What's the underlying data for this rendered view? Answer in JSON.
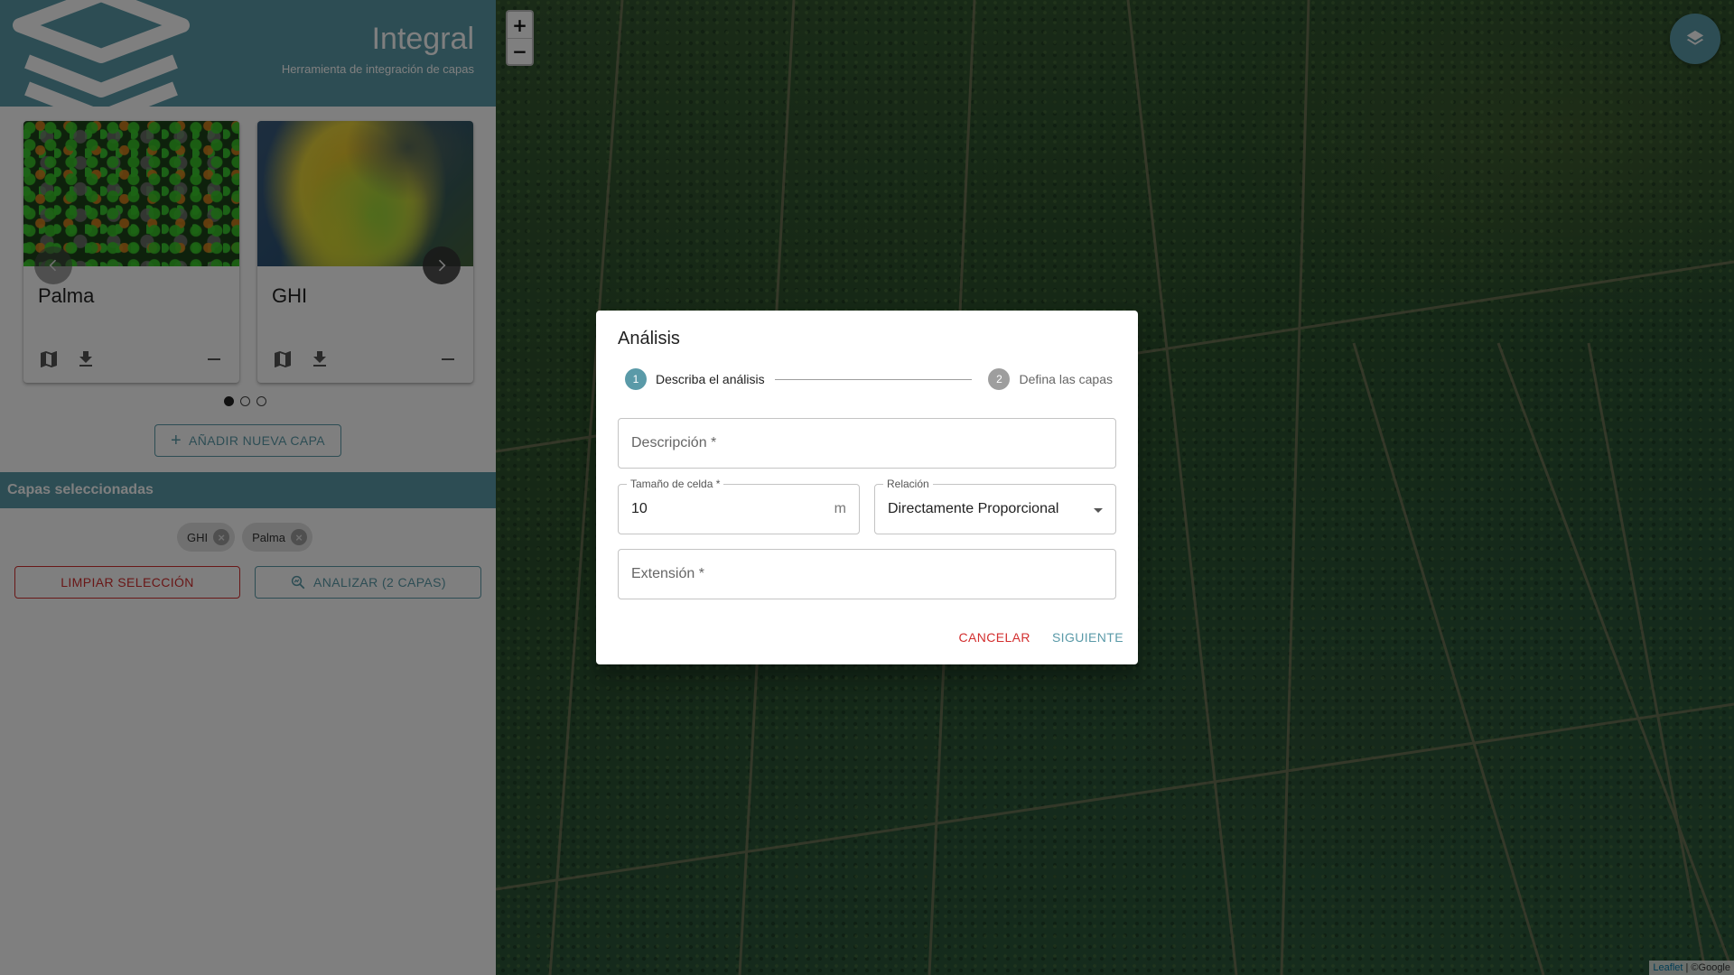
{
  "header": {
    "title": "Integral",
    "subtitle": "Herramienta de integración de capas"
  },
  "cards": [
    {
      "name": "Palma"
    },
    {
      "name": "GHI"
    }
  ],
  "carousel": {
    "pages": 3,
    "active_page": 1
  },
  "add_layer": {
    "label": "AÑADIR NUEVA CAPA"
  },
  "selected": {
    "title": "Capas seleccionadas",
    "chips": [
      "GHI",
      "Palma"
    ],
    "clear_label": "LIMPIAR SELECCIÓN",
    "analyze_label": "ANALIZAR (2 CAPAS)"
  },
  "map": {
    "zoom_in": "+",
    "zoom_out": "−",
    "attribution_leaflet": "Leaflet",
    "attribution_rest": " | ©Google"
  },
  "dialog": {
    "title": "Análisis",
    "steps": [
      {
        "num": "1",
        "label": "Describa el análisis"
      },
      {
        "num": "2",
        "label": "Defina las capas"
      }
    ],
    "fields": {
      "description": {
        "label": "Descripción *",
        "value": ""
      },
      "cell_size": {
        "label": "Tamaño de celda *",
        "value": "10",
        "unit": "m"
      },
      "relation": {
        "label": "Relación",
        "value": "Directamente Proporcional"
      },
      "extent": {
        "label": "Extensión *",
        "value": ""
      }
    },
    "cancel_label": "CANCELAR",
    "next_label": "SIGUIENTE"
  },
  "colors": {
    "primary": "#5a9aa8",
    "danger": "#d32f2f"
  }
}
